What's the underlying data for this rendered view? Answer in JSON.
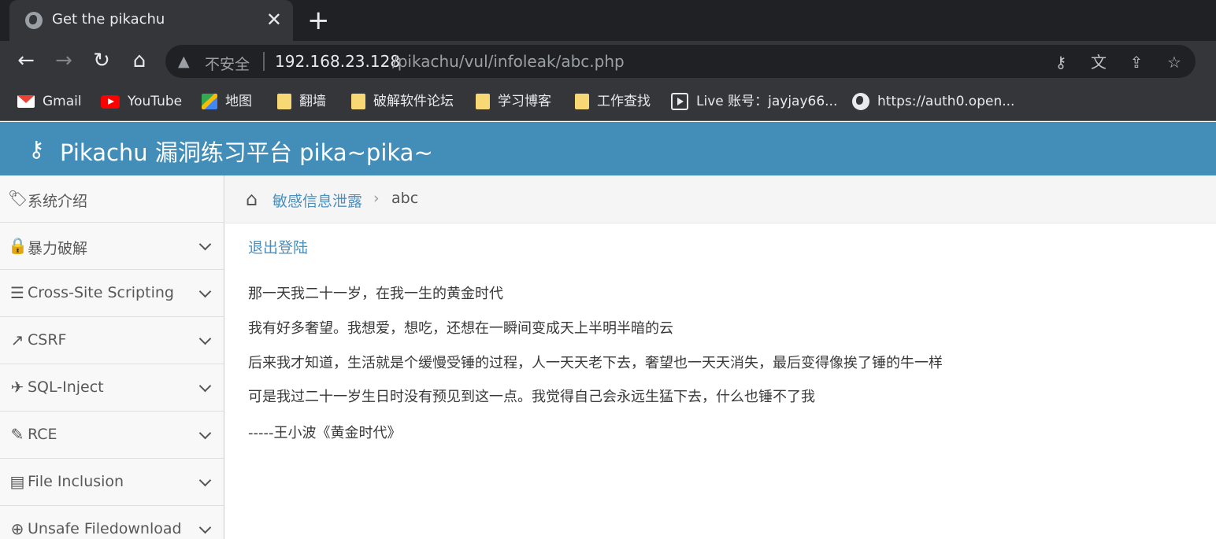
{
  "browser": {
    "tab_title": "Get the pikachu",
    "tab_close": "✕",
    "new_tab": "+",
    "insecure_label": "不安全",
    "url_host": "192.168.23.128",
    "url_path": "/pikachu/vul/infoleak/abc.php",
    "bookmarks": [
      {
        "label": "Gmail",
        "icon": "gmail-icon"
      },
      {
        "label": "YouTube",
        "icon": "youtube-icon"
      },
      {
        "label": "地图",
        "icon": "maps-icon"
      },
      {
        "label": "翻墙",
        "icon": "folder-icon"
      },
      {
        "label": "破解软件论坛",
        "icon": "folder-icon"
      },
      {
        "label": "学习博客",
        "icon": "folder-icon"
      },
      {
        "label": "工作查找",
        "icon": "folder-icon"
      },
      {
        "label": "Live 账号：jayjay66...",
        "icon": "live-icon"
      },
      {
        "label": "https://auth0.open...",
        "icon": "globe-icon"
      }
    ]
  },
  "header": {
    "title": "Pikachu 漏洞练习平台 pika~pika~",
    "color": "#438eb9"
  },
  "sidebar": {
    "items": [
      {
        "label": "系统介绍",
        "icon": "tags-icon"
      },
      {
        "label": "暴力破解",
        "icon": "lock-icon"
      },
      {
        "label": "Cross-Site Scripting",
        "icon": "indent-icon"
      },
      {
        "label": "CSRF",
        "icon": "share-icon"
      },
      {
        "label": "SQL-Inject",
        "icon": "plane-icon"
      },
      {
        "label": "RCE",
        "icon": "pencil-icon"
      },
      {
        "label": "File Inclusion",
        "icon": "file-icon"
      },
      {
        "label": "Unsafe Filedownload",
        "icon": "download-icon"
      }
    ]
  },
  "breadcrumb": {
    "parent": "敏感信息泄露",
    "current": "abc"
  },
  "main": {
    "logout": "退出登陆",
    "lines": [
      "那一天我二十一岁，在我一生的黄金时代",
      "我有好多奢望。我想爱，想吃，还想在一瞬间变成天上半明半暗的云",
      "后来我才知道，生活就是个缓慢受锤的过程，人一天天老下去，奢望也一天天消失，最后变得像挨了锤的牛一样",
      "可是我过二十一岁生日时没有预见到这一点。我觉得自己会永远生猛下去，什么也锤不了我",
      "-----王小波《黄金时代》"
    ]
  }
}
